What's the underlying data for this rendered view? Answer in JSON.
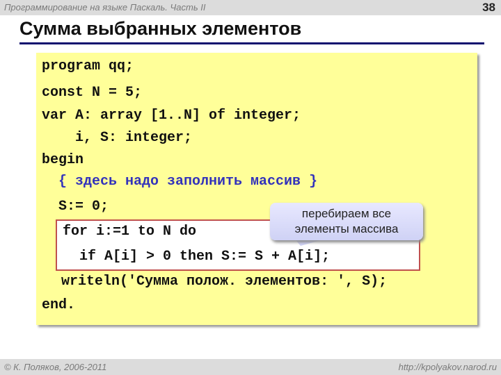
{
  "header": {
    "course_title": "Программирование на языке Паскаль. Часть II",
    "page_number": "38"
  },
  "slide": {
    "title": "Сумма выбранных элементов"
  },
  "code": {
    "lines": [
      "program qq;",
      "const N = 5;",
      "var A: array [1..N] of integer;",
      "    i, S: integer;",
      "begin",
      "  { здесь надо заполнить массив }",
      "  S:= 0;",
      "  for i:=1 to N do",
      "    if A[i] > 0 then S:= S + A[i];",
      "  writeln('Сумма полож. элементов: ', S);",
      "end."
    ]
  },
  "callout": {
    "line1": "перебираем все",
    "line2": "элементы массива"
  },
  "footer": {
    "copyright": "© К. Поляков, 2006-2011",
    "site": "http://kpolyakov.narod.ru"
  }
}
